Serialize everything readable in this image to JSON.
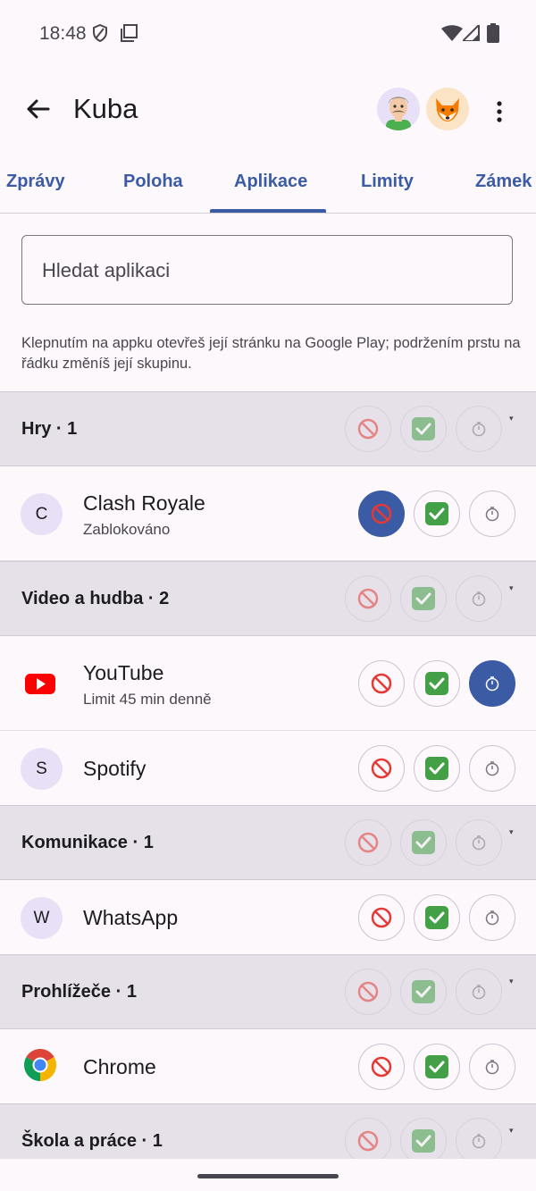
{
  "status_bar": {
    "time": "18:48",
    "icons": [
      "shield-icon",
      "screen-icon",
      "wifi-icon",
      "cell-signal-icon",
      "battery-icon"
    ]
  },
  "app_bar": {
    "title": "Kuba",
    "avatars": [
      "child-avatar",
      "fox-avatar"
    ]
  },
  "tabs": [
    {
      "label": "Zprávy",
      "selected": false
    },
    {
      "label": "Poloha",
      "selected": false
    },
    {
      "label": "Aplikace",
      "selected": true
    },
    {
      "label": "Limity",
      "selected": false
    },
    {
      "label": "Zámek",
      "selected": false
    }
  ],
  "search": {
    "placeholder": "Hledat aplikaci"
  },
  "hint": "Klepnutím na appku otevřeš její stránku na Google Play; podržením prstu na řádku změníš její skupinu.",
  "groups": [
    {
      "title": "Hry · 1",
      "apps": [
        {
          "name": "Clash Royale",
          "status": "Zablokováno",
          "icon": "C",
          "state": "block"
        }
      ]
    },
    {
      "title": "Video a hudba · 2",
      "apps": [
        {
          "name": "YouTube",
          "status": "Limit 45 min denně",
          "icon": "youtube-logo",
          "state": "limit"
        },
        {
          "name": "Spotify",
          "status": "",
          "icon": "S",
          "state": "none"
        }
      ]
    },
    {
      "title": "Komunikace · 1",
      "apps": [
        {
          "name": "WhatsApp",
          "status": "",
          "icon": "W",
          "state": "none"
        }
      ]
    },
    {
      "title": "Prohlížeče · 1",
      "apps": [
        {
          "name": "Chrome",
          "status": "",
          "icon": "chrome-logo",
          "state": "none"
        }
      ]
    },
    {
      "title": "Škola a práce · 1",
      "apps": []
    }
  ],
  "colors": {
    "accent": "#3B5BA5",
    "block": "#E53935",
    "allow": "#43A047",
    "group_bg": "#E6E1E8"
  }
}
